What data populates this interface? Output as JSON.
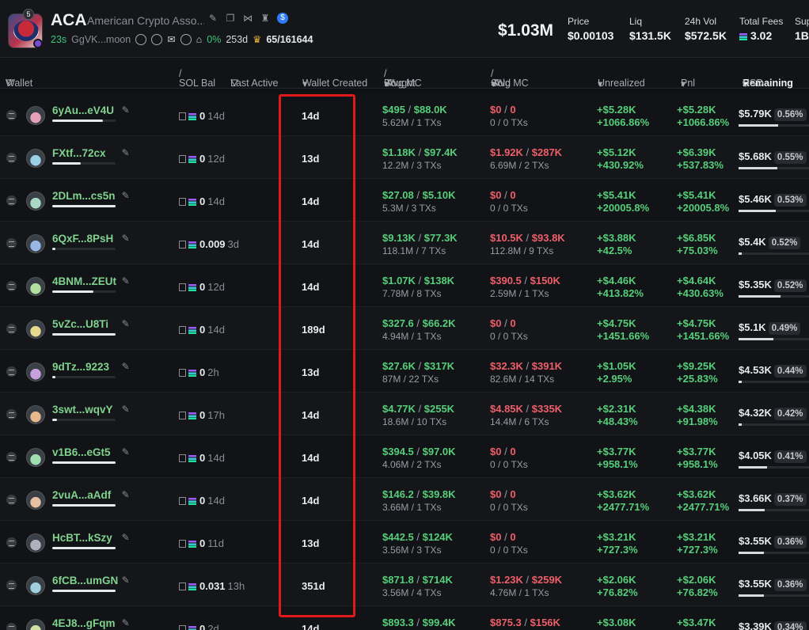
{
  "token": {
    "symbol": "ACA",
    "name": "American Crypto Asso...",
    "badge_count": "5",
    "age": "23s",
    "dev_address": "GgVK...moon",
    "top10_pct": "0%",
    "holders_age": "253d",
    "holders": "65/161644",
    "market_cap": "$1.03M"
  },
  "stats": [
    {
      "label": "Price",
      "value": "$0.00103"
    },
    {
      "label": "Liq",
      "value": "$131.5K"
    },
    {
      "label": "24h Vol",
      "value": "$572.5K"
    },
    {
      "label": "Total Fees",
      "value": "3.02"
    },
    {
      "label": "Sup",
      "value": "1B"
    }
  ],
  "columns": {
    "wallet": "Wallet",
    "sol_bal": "SOL Bal",
    "last_active": "Last Active",
    "wallet_created": "Wallet Created",
    "bought": "Bought",
    "avg_mc_1": "Avg MC",
    "sold": "Sold",
    "avg_mc_2": "Avg MC",
    "unrealized": "Unrealized",
    "pnl": "Pnl",
    "remaining": "Remaining",
    "usd": "USD"
  },
  "rows": [
    {
      "wallet": "6yAu...eV4U",
      "bar": 0.8,
      "sol": "0",
      "last": "14d",
      "created": "14d",
      "bought": "$495",
      "bought_mc": "$88.0K",
      "bought_sub": "5.62M / 1 TXs",
      "sold": "$0",
      "sold_mc": "0",
      "sold_sub": "0 / 0 TXs",
      "unr1": "+$5.28K",
      "unr2": "+1066.86%",
      "pnl1": "+$5.28K",
      "pnl2": "+1066.86%",
      "rem": "$5.79K",
      "rem_pct": "0.56%",
      "rem_fill": 0.56
    },
    {
      "wallet": "FXtf...72cx",
      "bar": 0.45,
      "sol": "0",
      "last": "12d",
      "created": "13d",
      "bought": "$1.18K",
      "bought_mc": "$97.4K",
      "bought_sub": "12.2M / 3 TXs",
      "sold": "$1.92K",
      "sold_mc": "$287K",
      "sold_sub": "6.69M / 2 TXs",
      "unr1": "+$5.12K",
      "unr2": "+430.92%",
      "pnl1": "+$6.39K",
      "pnl2": "+537.83%",
      "rem": "$5.68K",
      "rem_pct": "0.55%",
      "rem_fill": 0.55
    },
    {
      "wallet": "2DLm...cs5n",
      "bar": 1.0,
      "sol": "0",
      "last": "14d",
      "created": "14d",
      "bought": "$27.08",
      "bought_mc": "$5.10K",
      "bought_sub": "5.3M / 3 TXs",
      "sold": "$0",
      "sold_mc": "0",
      "sold_sub": "0 / 0 TXs",
      "unr1": "+$5.41K",
      "unr2": "+20005.8%",
      "pnl1": "+$5.41K",
      "pnl2": "+20005.8%",
      "rem": "$5.46K",
      "rem_pct": "0.53%",
      "rem_fill": 0.53
    },
    {
      "wallet": "6QxF...8PsH",
      "bar": 0.05,
      "sol": "0.009",
      "last": "3d",
      "created": "14d",
      "bought": "$9.13K",
      "bought_mc": "$77.3K",
      "bought_sub": "118.1M / 7 TXs",
      "sold": "$10.5K",
      "sold_mc": "$93.8K",
      "sold_sub": "112.8M / 9 TXs",
      "unr1": "+$3.88K",
      "unr2": "+42.5%",
      "pnl1": "+$6.85K",
      "pnl2": "+75.03%",
      "rem": "$5.4K",
      "rem_pct": "0.52%",
      "rem_fill": 0.05
    },
    {
      "wallet": "4BNM...ZEUt",
      "bar": 0.65,
      "sol": "0",
      "last": "12d",
      "created": "14d",
      "bought": "$1.07K",
      "bought_mc": "$138K",
      "bought_sub": "7.78M / 8 TXs",
      "sold": "$390.5",
      "sold_mc": "$150K",
      "sold_sub": "2.59M / 1 TXs",
      "unr1": "+$4.46K",
      "unr2": "+413.82%",
      "pnl1": "+$4.64K",
      "pnl2": "+430.63%",
      "rem": "$5.35K",
      "rem_pct": "0.52%",
      "rem_fill": 0.6
    },
    {
      "wallet": "5vZc...U8Ti",
      "bar": 1.0,
      "sol": "0",
      "last": "14d",
      "created": "189d",
      "bought": "$327.6",
      "bought_mc": "$66.2K",
      "bought_sub": "4.94M / 1 TXs",
      "sold": "$0",
      "sold_mc": "0",
      "sold_sub": "0 / 0 TXs",
      "unr1": "+$4.75K",
      "unr2": "+1451.66%",
      "pnl1": "+$4.75K",
      "pnl2": "+1451.66%",
      "rem": "$5.1K",
      "rem_pct": "0.49%",
      "rem_fill": 0.49
    },
    {
      "wallet": "9dTz...9223",
      "bar": 0.05,
      "sol": "0",
      "last": "2h",
      "created": "13d",
      "bought": "$27.6K",
      "bought_mc": "$317K",
      "bought_sub": "87M / 22 TXs",
      "sold": "$32.3K",
      "sold_mc": "$391K",
      "sold_sub": "82.6M / 14 TXs",
      "unr1": "+$1.05K",
      "unr2": "+2.95%",
      "pnl1": "+$9.25K",
      "pnl2": "+25.83%",
      "rem": "$4.53K",
      "rem_pct": "0.44%",
      "rem_fill": 0.05
    },
    {
      "wallet": "3swt...wqvY",
      "bar": 0.08,
      "sol": "0",
      "last": "17h",
      "created": "14d",
      "bought": "$4.77K",
      "bought_mc": "$255K",
      "bought_sub": "18.6M / 10 TXs",
      "sold": "$4.85K",
      "sold_mc": "$335K",
      "sold_sub": "14.4M / 6 TXs",
      "unr1": "+$2.31K",
      "unr2": "+48.43%",
      "pnl1": "+$4.38K",
      "pnl2": "+91.98%",
      "rem": "$4.32K",
      "rem_pct": "0.42%",
      "rem_fill": 0.05
    },
    {
      "wallet": "v1B6...eGt5",
      "bar": 1.0,
      "sol": "0",
      "last": "14d",
      "created": "14d",
      "bought": "$394.5",
      "bought_mc": "$97.0K",
      "bought_sub": "4.06M / 2 TXs",
      "sold": "$0",
      "sold_mc": "0",
      "sold_sub": "0 / 0 TXs",
      "unr1": "+$3.77K",
      "unr2": "+958.1%",
      "pnl1": "+$3.77K",
      "pnl2": "+958.1%",
      "rem": "$4.05K",
      "rem_pct": "0.41%",
      "rem_fill": 0.41
    },
    {
      "wallet": "2vuA...aAdf",
      "bar": 1.0,
      "sol": "0",
      "last": "14d",
      "created": "14d",
      "bought": "$146.2",
      "bought_mc": "$39.8K",
      "bought_sub": "3.66M / 1 TXs",
      "sold": "$0",
      "sold_mc": "0",
      "sold_sub": "0 / 0 TXs",
      "unr1": "+$3.62K",
      "unr2": "+2477.71%",
      "pnl1": "+$3.62K",
      "pnl2": "+2477.71%",
      "rem": "$3.66K",
      "rem_pct": "0.37%",
      "rem_fill": 0.37
    },
    {
      "wallet": "HcBT...kSzy",
      "bar": 1.0,
      "sol": "0",
      "last": "11d",
      "created": "13d",
      "bought": "$442.5",
      "bought_mc": "$124K",
      "bought_sub": "3.56M / 3 TXs",
      "sold": "$0",
      "sold_mc": "0",
      "sold_sub": "0 / 0 TXs",
      "unr1": "+$3.21K",
      "unr2": "+727.3%",
      "pnl1": "+$3.21K",
      "pnl2": "+727.3%",
      "rem": "$3.55K",
      "rem_pct": "0.36%",
      "rem_fill": 0.36
    },
    {
      "wallet": "6fCB...umGN",
      "bar": 1.0,
      "sol": "0.031",
      "last": "13h",
      "created": "351d",
      "bought": "$871.8",
      "bought_mc": "$714K",
      "bought_sub": "3.56M / 4 TXs",
      "sold": "$1.23K",
      "sold_mc": "$259K",
      "sold_sub": "4.76M / 1 TXs",
      "unr1": "+$2.06K",
      "unr2": "+76.82%",
      "pnl1": "+$2.06K",
      "pnl2": "+76.82%",
      "rem": "$3.55K",
      "rem_pct": "0.36%",
      "rem_fill": 0.36
    },
    {
      "wallet": "4EJ8...gFqm",
      "bar": 1.0,
      "sol": "0",
      "last": "2d",
      "created": "14d",
      "bought": "$893.3",
      "bought_mc": "$99.4K",
      "bought_sub": "",
      "sold": "$875.3",
      "sold_mc": "$156K",
      "sold_sub": "",
      "unr1": "+$3.08K",
      "unr2": "",
      "pnl1": "+$3.47K",
      "pnl2": "",
      "rem": "$3.39K",
      "rem_pct": "0.34%",
      "rem_fill": 0.34
    }
  ]
}
